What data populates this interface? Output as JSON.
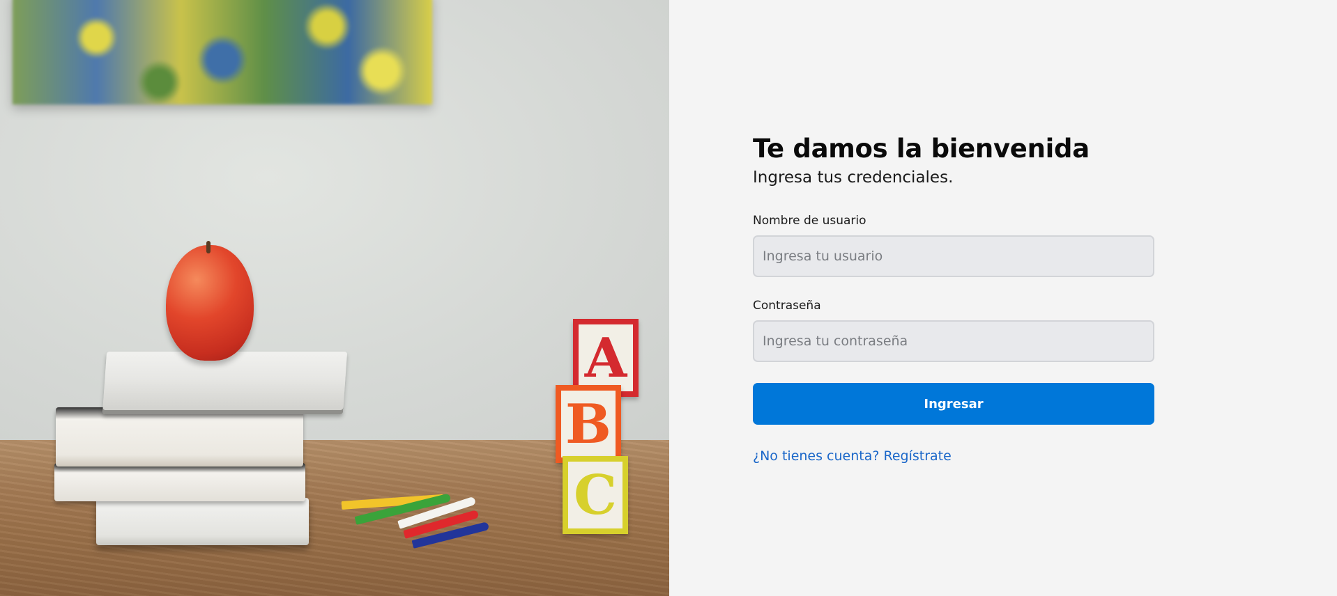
{
  "login": {
    "title": "Te damos la bienvenida",
    "subtitle": "Ingresa tus credenciales.",
    "username": {
      "label": "Nombre de usuario",
      "placeholder": "Ingresa tu usuario",
      "value": ""
    },
    "password": {
      "label": "Contraseña",
      "placeholder": "Ingresa tu contraseña",
      "value": ""
    },
    "submit_label": "Ingresar",
    "register_link": "¿No tienes cuenta? Regístrate"
  },
  "hero": {
    "blocks": [
      "A",
      "B",
      "C"
    ]
  },
  "colors": {
    "primary_button": "#0077d9",
    "link": "#1b67c9",
    "panel_background": "#f4f4f4",
    "input_background": "#e8e9ec"
  }
}
